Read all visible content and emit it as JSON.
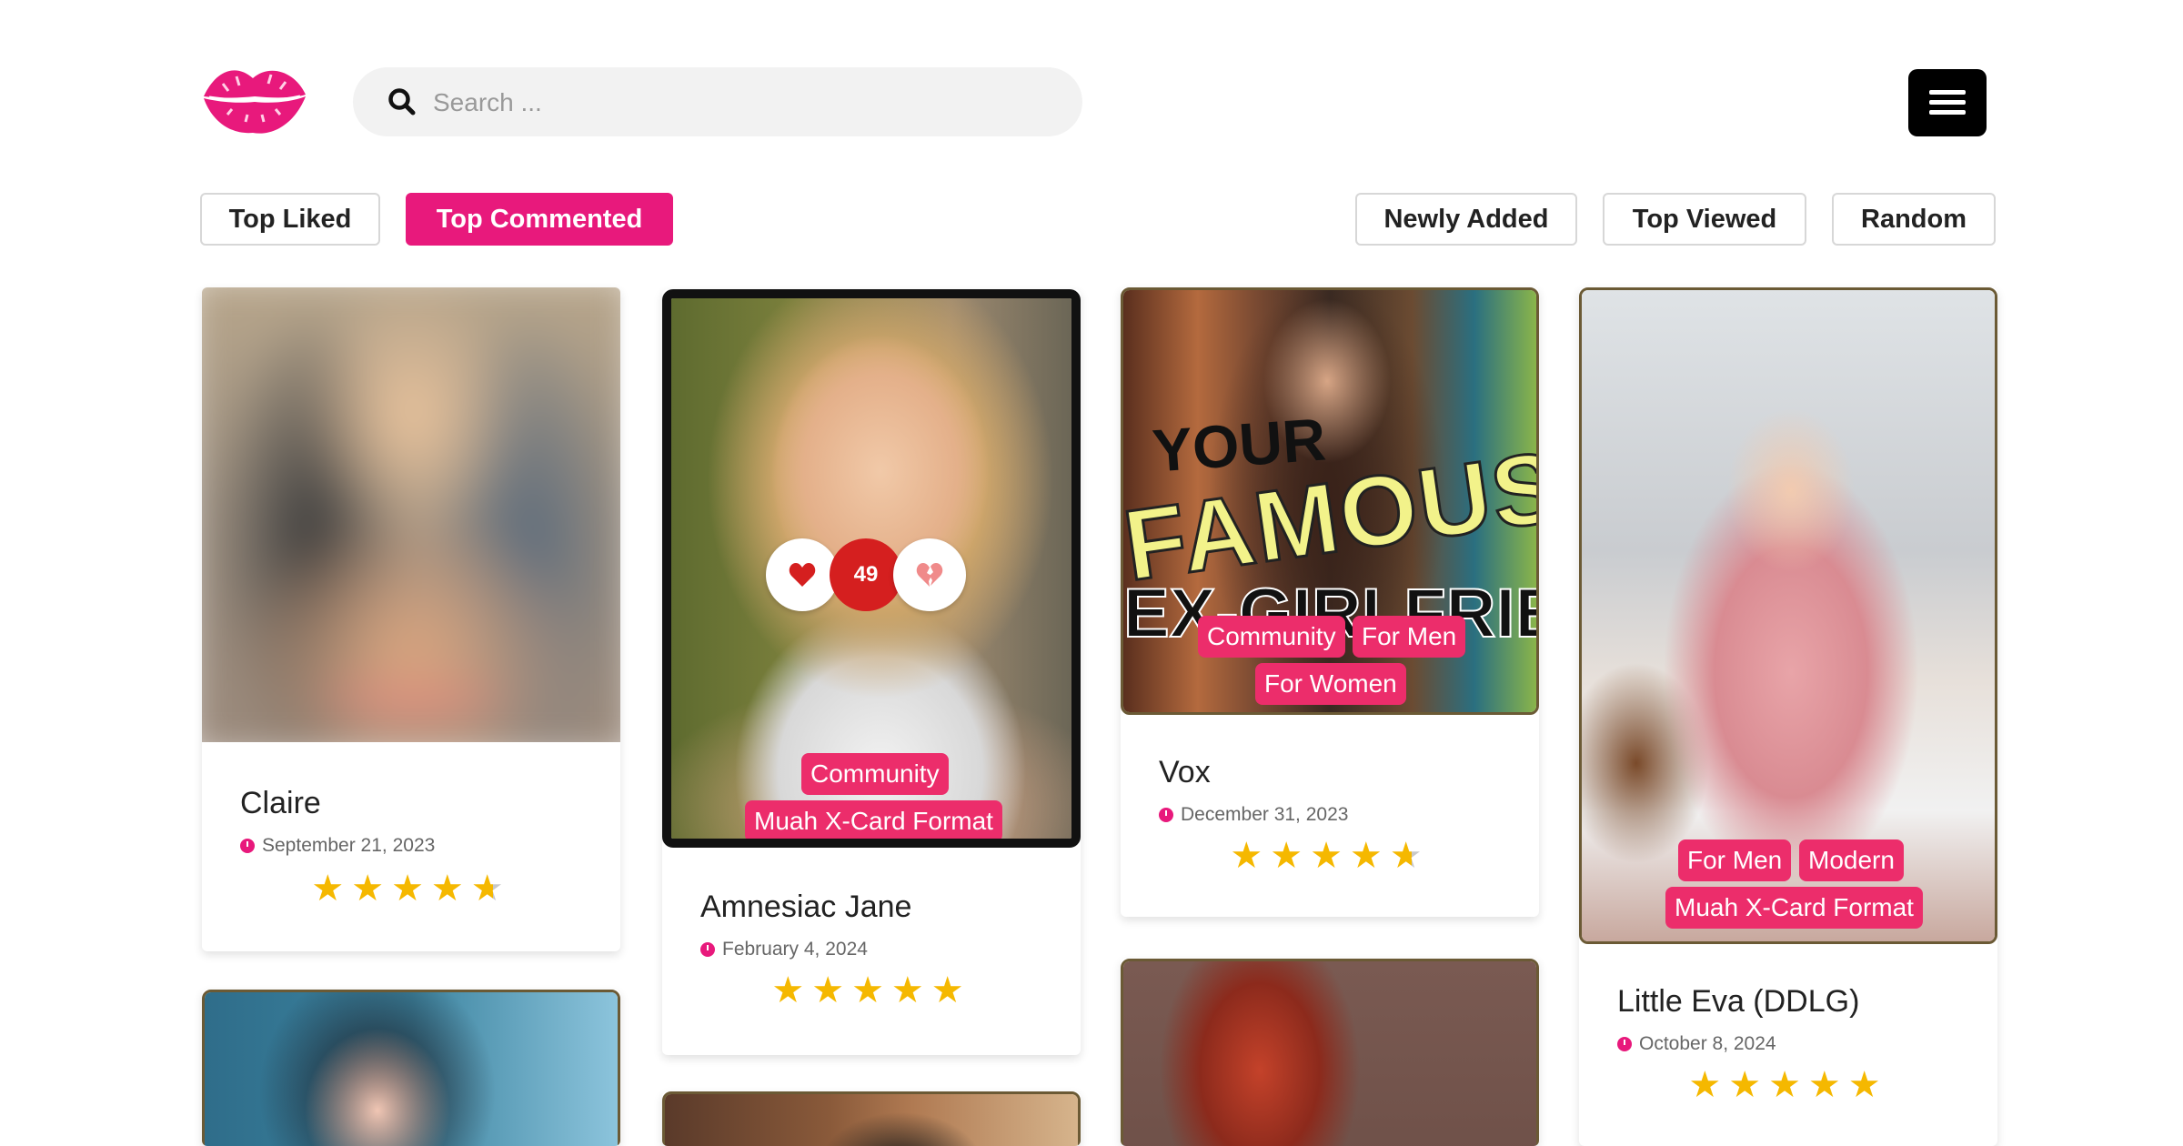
{
  "header": {
    "search_placeholder": "Search ...",
    "logo_icon": "lips-logo-icon",
    "menu_icon": "hamburger-menu-icon"
  },
  "filters": {
    "top_liked": "Top Liked",
    "top_commented": "Top Commented",
    "newly_added": "Newly Added",
    "top_viewed": "Top Viewed",
    "random": "Random",
    "active": "Top Commented"
  },
  "colors": {
    "accent": "#e8197c",
    "tag": "#ec2d6b",
    "star": "#f5b800",
    "vote_count_bg": "#d51f1f",
    "border": "#6b5a35"
  },
  "cards": [
    {
      "title": "Claire",
      "date": "September 21, 2023",
      "rating": 4.5,
      "tags": []
    },
    {
      "title": "Amnesiac Jane",
      "date": "February 4, 2024",
      "rating": 5,
      "tags": [
        "Community",
        "Muah X-Card Format"
      ],
      "votes": "49"
    },
    {
      "title": "Vox",
      "date": "December 31, 2023",
      "rating": 4.5,
      "tags": [
        "Community",
        "For Men",
        "For Women"
      ],
      "image_text": {
        "line1": "YOUR",
        "line2": "FAMOUS",
        "line3": "EX-GIRLFRIEND"
      }
    },
    {
      "title": "Little Eva (DDLG)",
      "date": "October 8, 2024",
      "rating": 5,
      "tags": [
        "For Men",
        "Modern",
        "Muah X-Card Format"
      ]
    }
  ]
}
